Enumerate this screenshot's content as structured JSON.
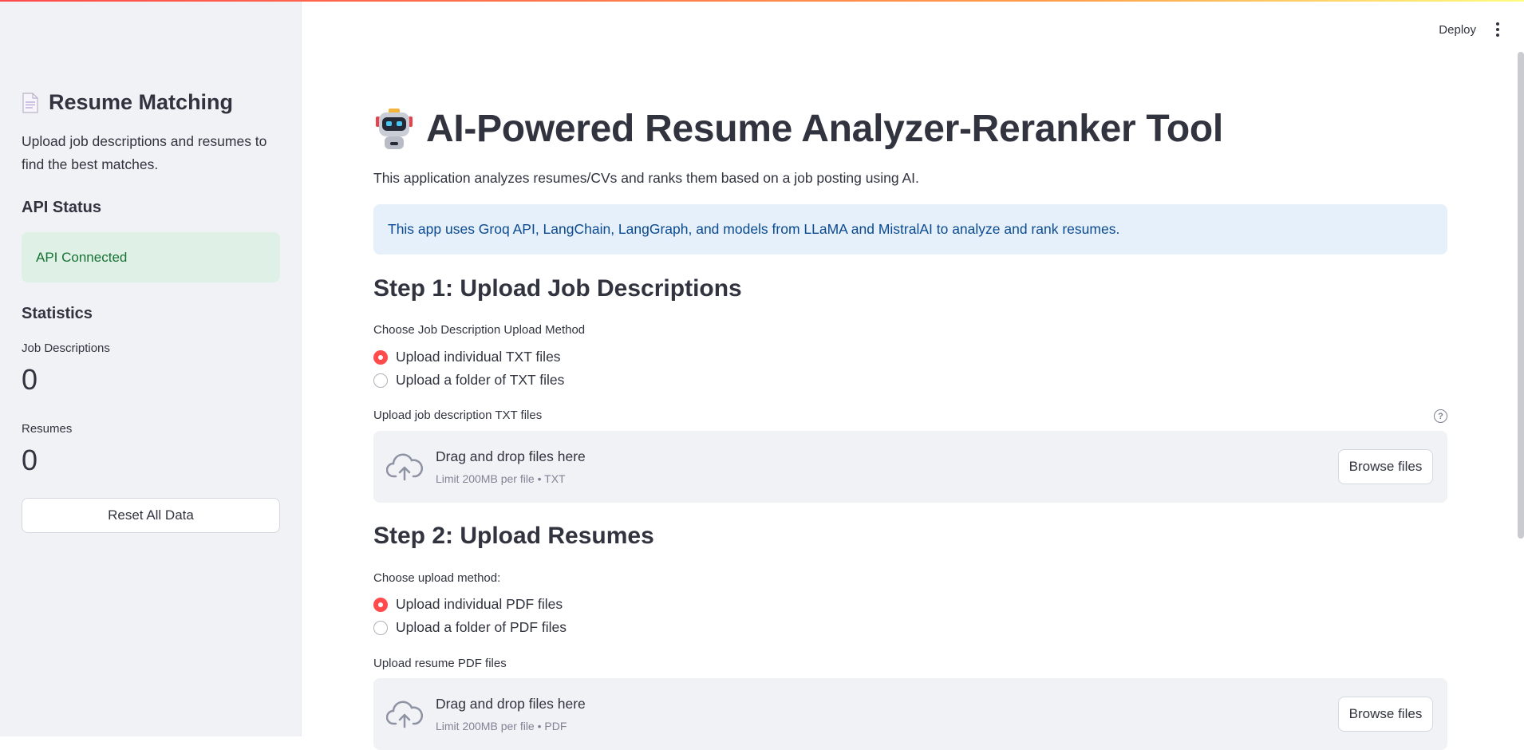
{
  "sidebar": {
    "title": "Resume Matching",
    "description": "Upload job descriptions and resumes to find the best matches.",
    "api_status_heading": "API Status",
    "api_status_text": "API Connected",
    "statistics_heading": "Statistics",
    "job_descriptions_label": "Job Descriptions",
    "job_descriptions_value": "0",
    "resumes_label": "Resumes",
    "resumes_value": "0",
    "reset_button": "Reset All Data"
  },
  "header": {
    "deploy_label": "Deploy"
  },
  "main": {
    "title": "AI-Powered Resume Analyzer-Reranker Tool",
    "subtitle": "This application analyzes resumes/CVs and ranks them based on a job posting using AI.",
    "info": "This app uses Groq API, LangChain, LangGraph, and models from LLaMA and MistralAI to analyze and rank resumes.",
    "step1": {
      "heading": "Step 1: Upload Job Descriptions",
      "method_label": "Choose Job Description Upload Method",
      "options": [
        "Upload individual TXT files",
        "Upload a folder of TXT files"
      ],
      "selected_index": 0,
      "uploader_label": "Upload job description TXT files",
      "help_glyph": "?",
      "drop_text": "Drag and drop files here",
      "limit_text": "Limit 200MB per file • TXT",
      "browse_label": "Browse files"
    },
    "step2": {
      "heading": "Step 2: Upload Resumes",
      "method_label": "Choose upload method:",
      "options": [
        "Upload individual PDF files",
        "Upload a folder of PDF files"
      ],
      "selected_index": 0,
      "uploader_label": "Upload resume PDF files",
      "drop_text": "Drag and drop files here",
      "limit_text": "Limit 200MB per file • PDF",
      "browse_label": "Browse files"
    }
  },
  "colors": {
    "accent": "#ff4b4b",
    "success_bg": "#dff0e6",
    "success_text": "#177233",
    "info_bg": "#e6f0fb",
    "info_text": "#0b4a8f",
    "sidebar_bg": "#f0f2f6"
  },
  "icons": {
    "sidebar_title": "document-icon",
    "main_title": "robot-icon",
    "uploader": "cloud-upload-icon",
    "help": "help-icon",
    "menu": "kebab-menu-icon"
  }
}
